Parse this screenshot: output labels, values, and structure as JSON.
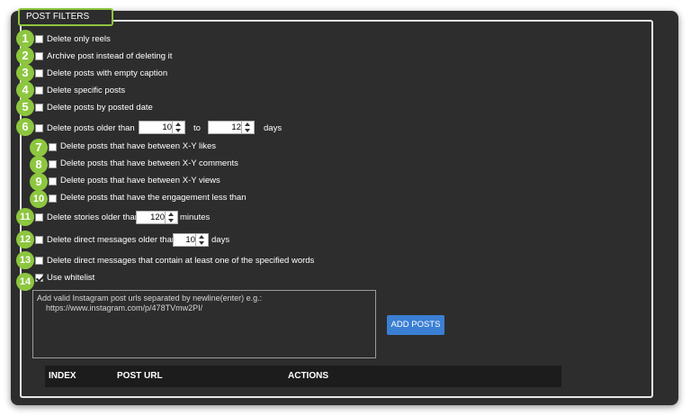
{
  "section_title": "POST FILTERS",
  "options": [
    {
      "num": "1",
      "label": "Delete only reels",
      "checked": false
    },
    {
      "num": "2",
      "label": "Archive post instead of deleting it",
      "checked": false
    },
    {
      "num": "3",
      "label": "Delete posts with empty caption",
      "checked": false
    },
    {
      "num": "4",
      "label": "Delete specific posts",
      "checked": false
    },
    {
      "num": "5",
      "label": "Delete posts by posted date",
      "checked": false
    },
    {
      "num": "6",
      "label": "Delete posts older than",
      "checked": false,
      "from_value": "10",
      "to_label": "to",
      "to_value": "12",
      "unit": "days"
    },
    {
      "num": "7",
      "label": "Delete posts that have between X-Y likes",
      "checked": false
    },
    {
      "num": "8",
      "label": "Delete posts that have between X-Y comments",
      "checked": false
    },
    {
      "num": "9",
      "label": "Delete posts that have between X-Y views",
      "checked": false
    },
    {
      "num": "10",
      "label": "Delete posts that have the engagement less than",
      "checked": false
    },
    {
      "num": "11",
      "label": "Delete stories older than",
      "checked": false,
      "value": "120",
      "unit": "minutes"
    },
    {
      "num": "12",
      "label": "Delete direct messages older than",
      "checked": false,
      "value": "10",
      "unit": "days"
    },
    {
      "num": "13",
      "label": "Delete direct messages that contain at least one of the specified words",
      "checked": false
    },
    {
      "num": "14",
      "label": "Use whitelist",
      "checked": true
    }
  ],
  "whitelist_placeholder": "Add valid Instagram post urls separated by newline(enter) e.g.:\n    https://www.instagram.com/p/478TVmw2PI/",
  "add_posts_label": "ADD POSTS",
  "table": {
    "columns": [
      "INDEX",
      "POST URL",
      "ACTIONS"
    ]
  },
  "colors": {
    "accent_green": "#8dc63f",
    "button_blue": "#3b7fd4",
    "panel_bg": "#2d2d2d"
  }
}
